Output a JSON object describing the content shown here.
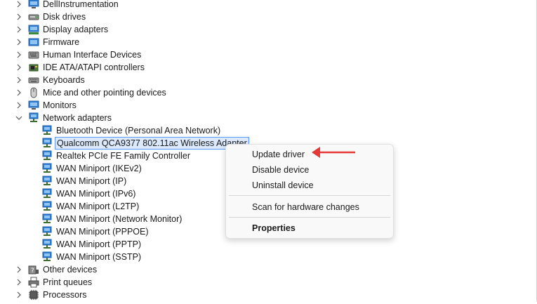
{
  "tree": {
    "categories_before": [
      {
        "label": "DellInstrumentation",
        "icon": "monitor-icon",
        "expanded": false
      },
      {
        "label": "Disk drives",
        "icon": "disk-drive-icon",
        "expanded": false
      },
      {
        "label": "Display adapters",
        "icon": "display-adapter-icon",
        "expanded": false
      },
      {
        "label": "Firmware",
        "icon": "firmware-icon",
        "expanded": false
      },
      {
        "label": "Human Interface Devices",
        "icon": "hid-icon",
        "expanded": false
      },
      {
        "label": "IDE ATA/ATAPI controllers",
        "icon": "ide-controller-icon",
        "expanded": false
      },
      {
        "label": "Keyboards",
        "icon": "keyboard-icon",
        "expanded": false
      },
      {
        "label": "Mice and other pointing devices",
        "icon": "mouse-icon",
        "expanded": false
      },
      {
        "label": "Monitors",
        "icon": "monitor-icon",
        "expanded": false
      }
    ],
    "network": {
      "label": "Network adapters",
      "icon": "network-adapter-icon",
      "expanded": true,
      "children": [
        {
          "label": "Bluetooth Device (Personal Area Network)"
        },
        {
          "label": "Qualcomm QCA9377 802.11ac Wireless Adapter",
          "selected": true
        },
        {
          "label": "Realtek PCIe FE Family Controller"
        },
        {
          "label": "WAN Miniport (IKEv2)"
        },
        {
          "label": "WAN Miniport (IP)"
        },
        {
          "label": "WAN Miniport (IPv6)"
        },
        {
          "label": "WAN Miniport (L2TP)"
        },
        {
          "label": "WAN Miniport (Network Monitor)"
        },
        {
          "label": "WAN Miniport (PPPOE)"
        },
        {
          "label": "WAN Miniport (PPTP)"
        },
        {
          "label": "WAN Miniport (SSTP)"
        }
      ]
    },
    "categories_after": [
      {
        "label": "Other devices",
        "icon": "unknown-device-icon",
        "expanded": false
      },
      {
        "label": "Print queues",
        "icon": "printer-icon",
        "expanded": false
      },
      {
        "label": "Processors",
        "icon": "processor-icon",
        "expanded": false
      }
    ]
  },
  "context_menu": {
    "update_driver": "Update driver",
    "disable_device": "Disable device",
    "uninstall_device": "Uninstall device",
    "scan_hardware": "Scan for hardware changes",
    "properties": "Properties"
  },
  "colors": {
    "selection_bg": "#dbe9fb",
    "selection_border": "#5a9cf0",
    "annotation_arrow": "#e53935"
  }
}
